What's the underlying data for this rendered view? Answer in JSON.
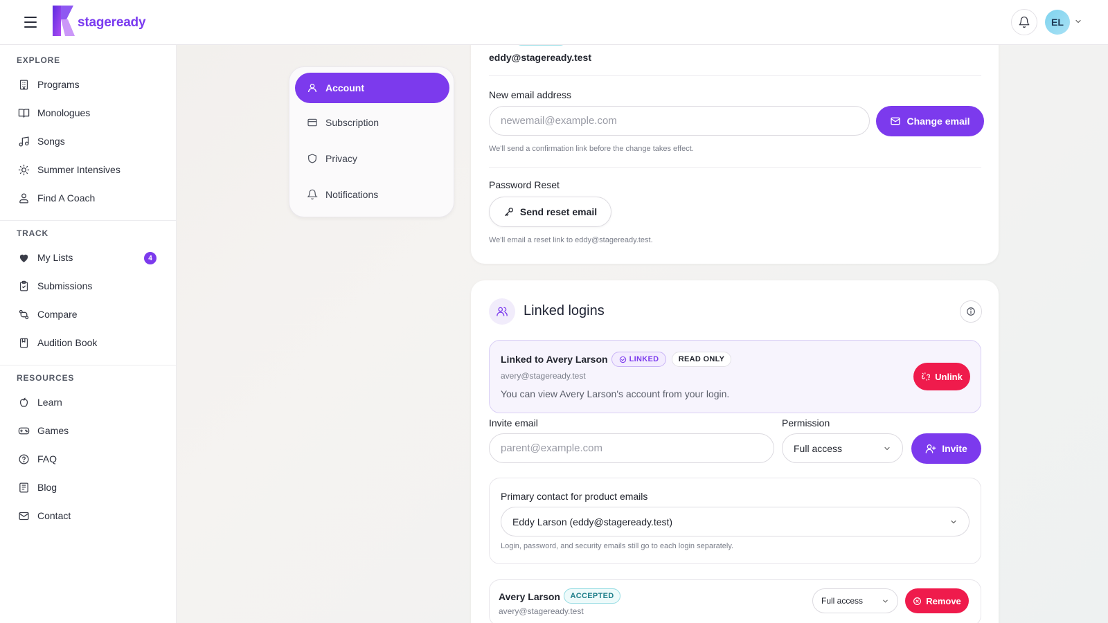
{
  "brand": {
    "logo_text": "stageready",
    "accent": "#7c3aed",
    "danger": "#ef1b4c"
  },
  "header": {
    "avatar_initials": "EL"
  },
  "sidebar": {
    "sections": [
      {
        "title": "EXPLORE",
        "items": [
          {
            "label": "Programs",
            "icon": "building-icon"
          },
          {
            "label": "Monologues",
            "icon": "book-open-icon"
          },
          {
            "label": "Songs",
            "icon": "music-note-icon"
          },
          {
            "label": "Summer Intensives",
            "icon": "sun-icon"
          },
          {
            "label": "Find A Coach",
            "icon": "users-icon"
          }
        ]
      },
      {
        "title": "TRACK",
        "items": [
          {
            "label": "My Lists",
            "icon": "heart-icon",
            "badge": "4"
          },
          {
            "label": "Submissions",
            "icon": "clipboard-check-icon"
          },
          {
            "label": "Compare",
            "icon": "git-compare-icon"
          },
          {
            "label": "Audition Book",
            "icon": "bookmark-book-icon"
          }
        ]
      },
      {
        "title": "RESOURCES",
        "items": [
          {
            "label": "Learn",
            "icon": "apple-icon"
          },
          {
            "label": "Games",
            "icon": "gamepad-icon"
          },
          {
            "label": "FAQ",
            "icon": "help-circle-icon"
          },
          {
            "label": "Blog",
            "icon": "newspaper-icon"
          },
          {
            "label": "Contact",
            "icon": "mail-icon"
          }
        ]
      }
    ]
  },
  "settings_nav": {
    "items": [
      {
        "label": "Account",
        "icon": "user-icon",
        "active": true
      },
      {
        "label": "Subscription",
        "icon": "credit-card-icon"
      },
      {
        "label": "Privacy",
        "icon": "shield-icon"
      },
      {
        "label": "Notifications",
        "icon": "bell-icon"
      }
    ]
  },
  "account": {
    "current_email": "eddy@stageready.test",
    "new_email": {
      "label": "New email address",
      "placeholder": "newemail@example.com",
      "button": "Change email",
      "hint": "We'll send a confirmation link before the change takes effect."
    },
    "password_reset": {
      "label": "Password Reset",
      "button": "Send reset email",
      "hint": "We'll email a reset link to eddy@stageready.test."
    }
  },
  "linked_logins": {
    "title": "Linked logins",
    "linked": {
      "title": "Linked to Avery Larson",
      "status_badge": "LINKED",
      "access_badge": "READ ONLY",
      "email": "avery@stageready.test",
      "description": "You can view Avery Larson's account from your login.",
      "unlink_button": "Unlink"
    },
    "invite": {
      "email_label": "Invite email",
      "email_placeholder": "parent@example.com",
      "permission_label": "Permission",
      "permission_value": "Full access",
      "button": "Invite"
    },
    "primary_contact": {
      "label": "Primary contact for product emails",
      "value": "Eddy Larson (eddy@stageready.test)",
      "hint": "Login, password, and security emails still go to each login separately."
    },
    "member": {
      "name": "Avery Larson",
      "status_badge": "ACCEPTED",
      "email": "avery@stageready.test",
      "permission_value": "Full access",
      "remove_button": "Remove"
    }
  }
}
